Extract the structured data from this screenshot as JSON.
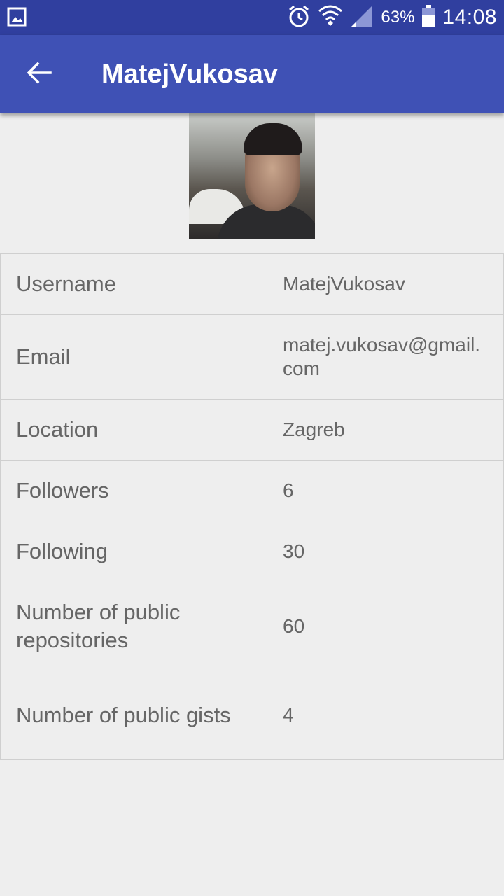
{
  "status_bar": {
    "battery": "63%",
    "time": "14:08",
    "icons": [
      "gallery-icon",
      "alarm-icon",
      "wifi-icon",
      "signal-icon",
      "battery-icon"
    ]
  },
  "app_bar": {
    "title": "MatejVukosav",
    "back_icon": "arrow-back-icon"
  },
  "profile": {
    "rows": [
      {
        "label": "Username",
        "value": "MatejVukosav"
      },
      {
        "label": "Email",
        "value": "matej.vukosav@gmail.com"
      },
      {
        "label": "Location",
        "value": "Zagreb"
      },
      {
        "label": "Followers",
        "value": "6"
      },
      {
        "label": "Following",
        "value": "30"
      },
      {
        "label": "Number of public repositories",
        "value": "60"
      },
      {
        "label": "Number of public gists",
        "value": "4"
      }
    ]
  },
  "colors": {
    "status_bar": "#303f9f",
    "app_bar": "#3f51b5",
    "background": "#eeeeee",
    "text": "#666666"
  }
}
